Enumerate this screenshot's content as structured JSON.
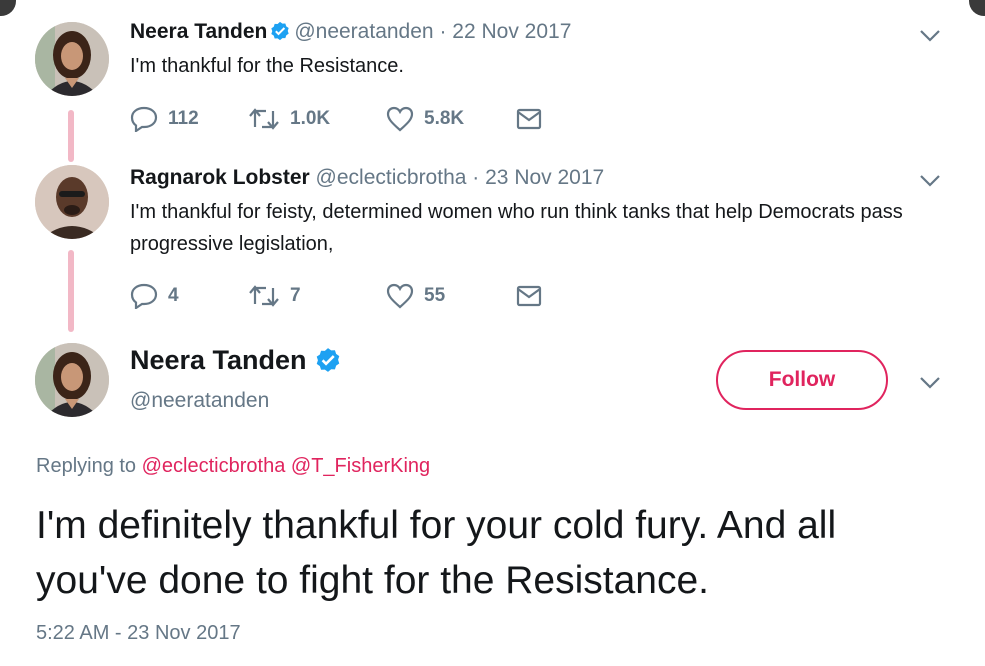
{
  "tweets": [
    {
      "name": "Neera Tanden",
      "handle": "@neeratanden",
      "sep": "·",
      "date": "22 Nov 2017",
      "text": "I'm thankful for the Resistance.",
      "replies": "112",
      "retweets": "1.0K",
      "likes": "5.8K"
    },
    {
      "name": "Ragnarok Lobster",
      "handle": "@eclecticbrotha",
      "sep": "·",
      "date": "23 Nov 2017",
      "text": "I'm thankful for feisty, determined women who run think tanks that help Democrats pass progressive legislation,",
      "replies": "4",
      "retweets": "7",
      "likes": "55"
    }
  ],
  "main": {
    "name": "Neera Tanden",
    "handle": "@neeratanden",
    "follow_label": "Follow",
    "replying_prefix": "Replying to",
    "mention_1": "@eclecticbrotha",
    "mention_2": "@T_FisherKing",
    "text": "I'm definitely thankful for your cold fury.  And all you've done to fight for the Resistance.",
    "timestamp": "5:22 AM - 23 Nov 2017"
  },
  "icons": {
    "reply": "reply-icon",
    "retweet": "retweet-icon",
    "like": "heart-icon",
    "message": "envelope-icon",
    "more": "chevron-down-icon",
    "verified": "verified-badge-icon"
  },
  "colors": {
    "accent": "#e0245e",
    "verified": "#1da1f2",
    "muted": "#657786",
    "thread_line": "#f2b8c6"
  }
}
